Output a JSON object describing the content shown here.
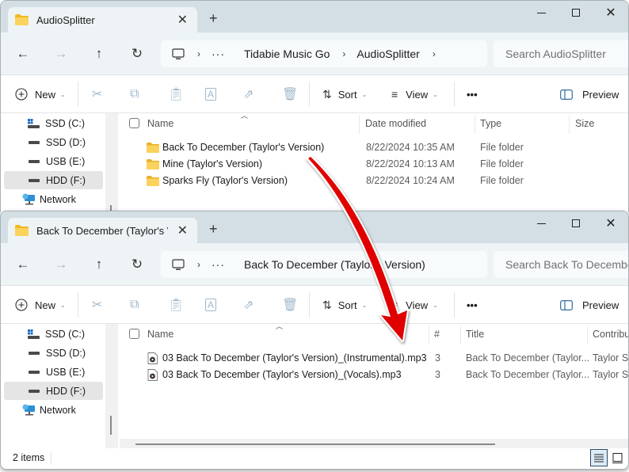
{
  "window1": {
    "tab_title": "AudioSplitter",
    "new_tab_label": "+",
    "breadcrumb": [
      "Tidabie Music Go",
      "AudioSplitter"
    ],
    "search_placeholder": "Search AudioSplitter",
    "toolbar": {
      "new_label": "New",
      "sort_label": "Sort",
      "view_label": "View",
      "more_label": "•••",
      "preview_label": "Preview"
    },
    "sidebar": [
      {
        "label": "SSD (C:)",
        "icon": "windows-drive-icon",
        "selected": false
      },
      {
        "label": "SSD (D:)",
        "icon": "drive-icon",
        "selected": false
      },
      {
        "label": "USB (E:)",
        "icon": "drive-icon",
        "selected": false
      },
      {
        "label": "HDD (F:)",
        "icon": "drive-icon",
        "selected": true
      },
      {
        "label": "Network",
        "icon": "network-icon",
        "selected": false
      }
    ],
    "columns": [
      "Name",
      "Date modified",
      "Type",
      "Size"
    ],
    "rows": [
      {
        "name": "Back To December (Taylor's Version)",
        "date": "8/22/2024 10:35 AM",
        "type": "File folder",
        "size": ""
      },
      {
        "name": "Mine (Taylor's Version)",
        "date": "8/22/2024 10:13 AM",
        "type": "File folder",
        "size": ""
      },
      {
        "name": "Sparks Fly (Taylor's Version)",
        "date": "8/22/2024 10:24 AM",
        "type": "File folder",
        "size": ""
      }
    ]
  },
  "window2": {
    "tab_title": "Back To December (Taylor's Version)",
    "tab_title_visible": "Back To December (Taylor's Ve",
    "new_tab_label": "+",
    "breadcrumb": [
      "Back To December (Taylor's Version)"
    ],
    "search_placeholder": "Search Back To December (Taylor's Version)",
    "toolbar": {
      "new_label": "New",
      "sort_label": "Sort",
      "view_label": "View",
      "more_label": "•••",
      "preview_label": "Preview"
    },
    "sidebar": [
      {
        "label": "SSD (C:)",
        "icon": "windows-drive-icon",
        "selected": false
      },
      {
        "label": "SSD (D:)",
        "icon": "drive-icon",
        "selected": false
      },
      {
        "label": "USB (E:)",
        "icon": "drive-icon",
        "selected": false
      },
      {
        "label": "HDD (F:)",
        "icon": "drive-icon",
        "selected": true
      },
      {
        "label": "Network",
        "icon": "network-icon",
        "selected": false
      }
    ],
    "columns": [
      "Name",
      "#",
      "Title",
      "Contributing artists"
    ],
    "columns_visible": [
      "Name",
      "#",
      "Title",
      "Contribu"
    ],
    "rows": [
      {
        "name": "03 Back To December (Taylor's Version)_(Instrumental).mp3",
        "track": "3",
        "title": "Back To December (Taylor...",
        "artist": "Taylor Sw"
      },
      {
        "name": "03 Back To December (Taylor's Version)_(Vocals).mp3",
        "track": "3",
        "title": "Back To December (Taylor...",
        "artist": "Taylor Sw"
      }
    ],
    "status": {
      "item_count": "2 items"
    }
  },
  "annotation": {
    "type": "curved-arrow",
    "color": "#e00000",
    "from": "Back To December (Taylor's Version) folder",
    "to": "split mp3 files"
  },
  "colors": {
    "titlebar": "#d3dfe4",
    "navbar": "#eef4f6",
    "folder": "#f5c542",
    "selected_sidebar": "#e5e5e5"
  }
}
